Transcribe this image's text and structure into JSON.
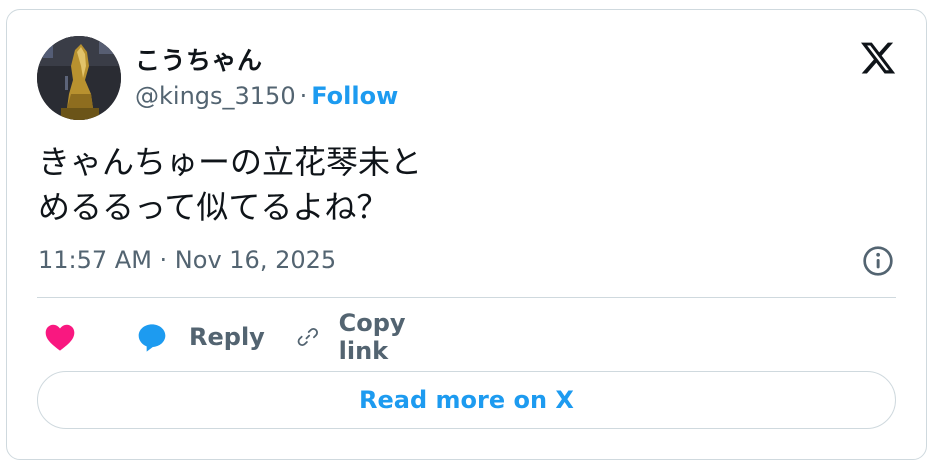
{
  "author": {
    "display_name": "こうちゃん",
    "handle": "@kings_3150",
    "separator": "·",
    "follow_label": "Follow"
  },
  "tweet": {
    "lines": [
      "きゃんちゅーの立花琴未と",
      "めるるって似てるよね？"
    ],
    "timestamp": "11:57 AM · Nov 16, 2025"
  },
  "actions": {
    "reply_label": "Reply",
    "copy_link_label": "Copy link"
  },
  "read_more_label": "Read more on X",
  "icons": {
    "x_logo": "x-logo-icon",
    "info": "info-icon",
    "like": "heart-icon",
    "reply": "speech-bubble-icon",
    "copy": "link-icon"
  },
  "colors": {
    "brand_blue": "#1d9bf0",
    "like_pink": "#f91880",
    "text_primary": "#0f1419",
    "text_secondary": "#536471",
    "border": "#cfd9de"
  }
}
